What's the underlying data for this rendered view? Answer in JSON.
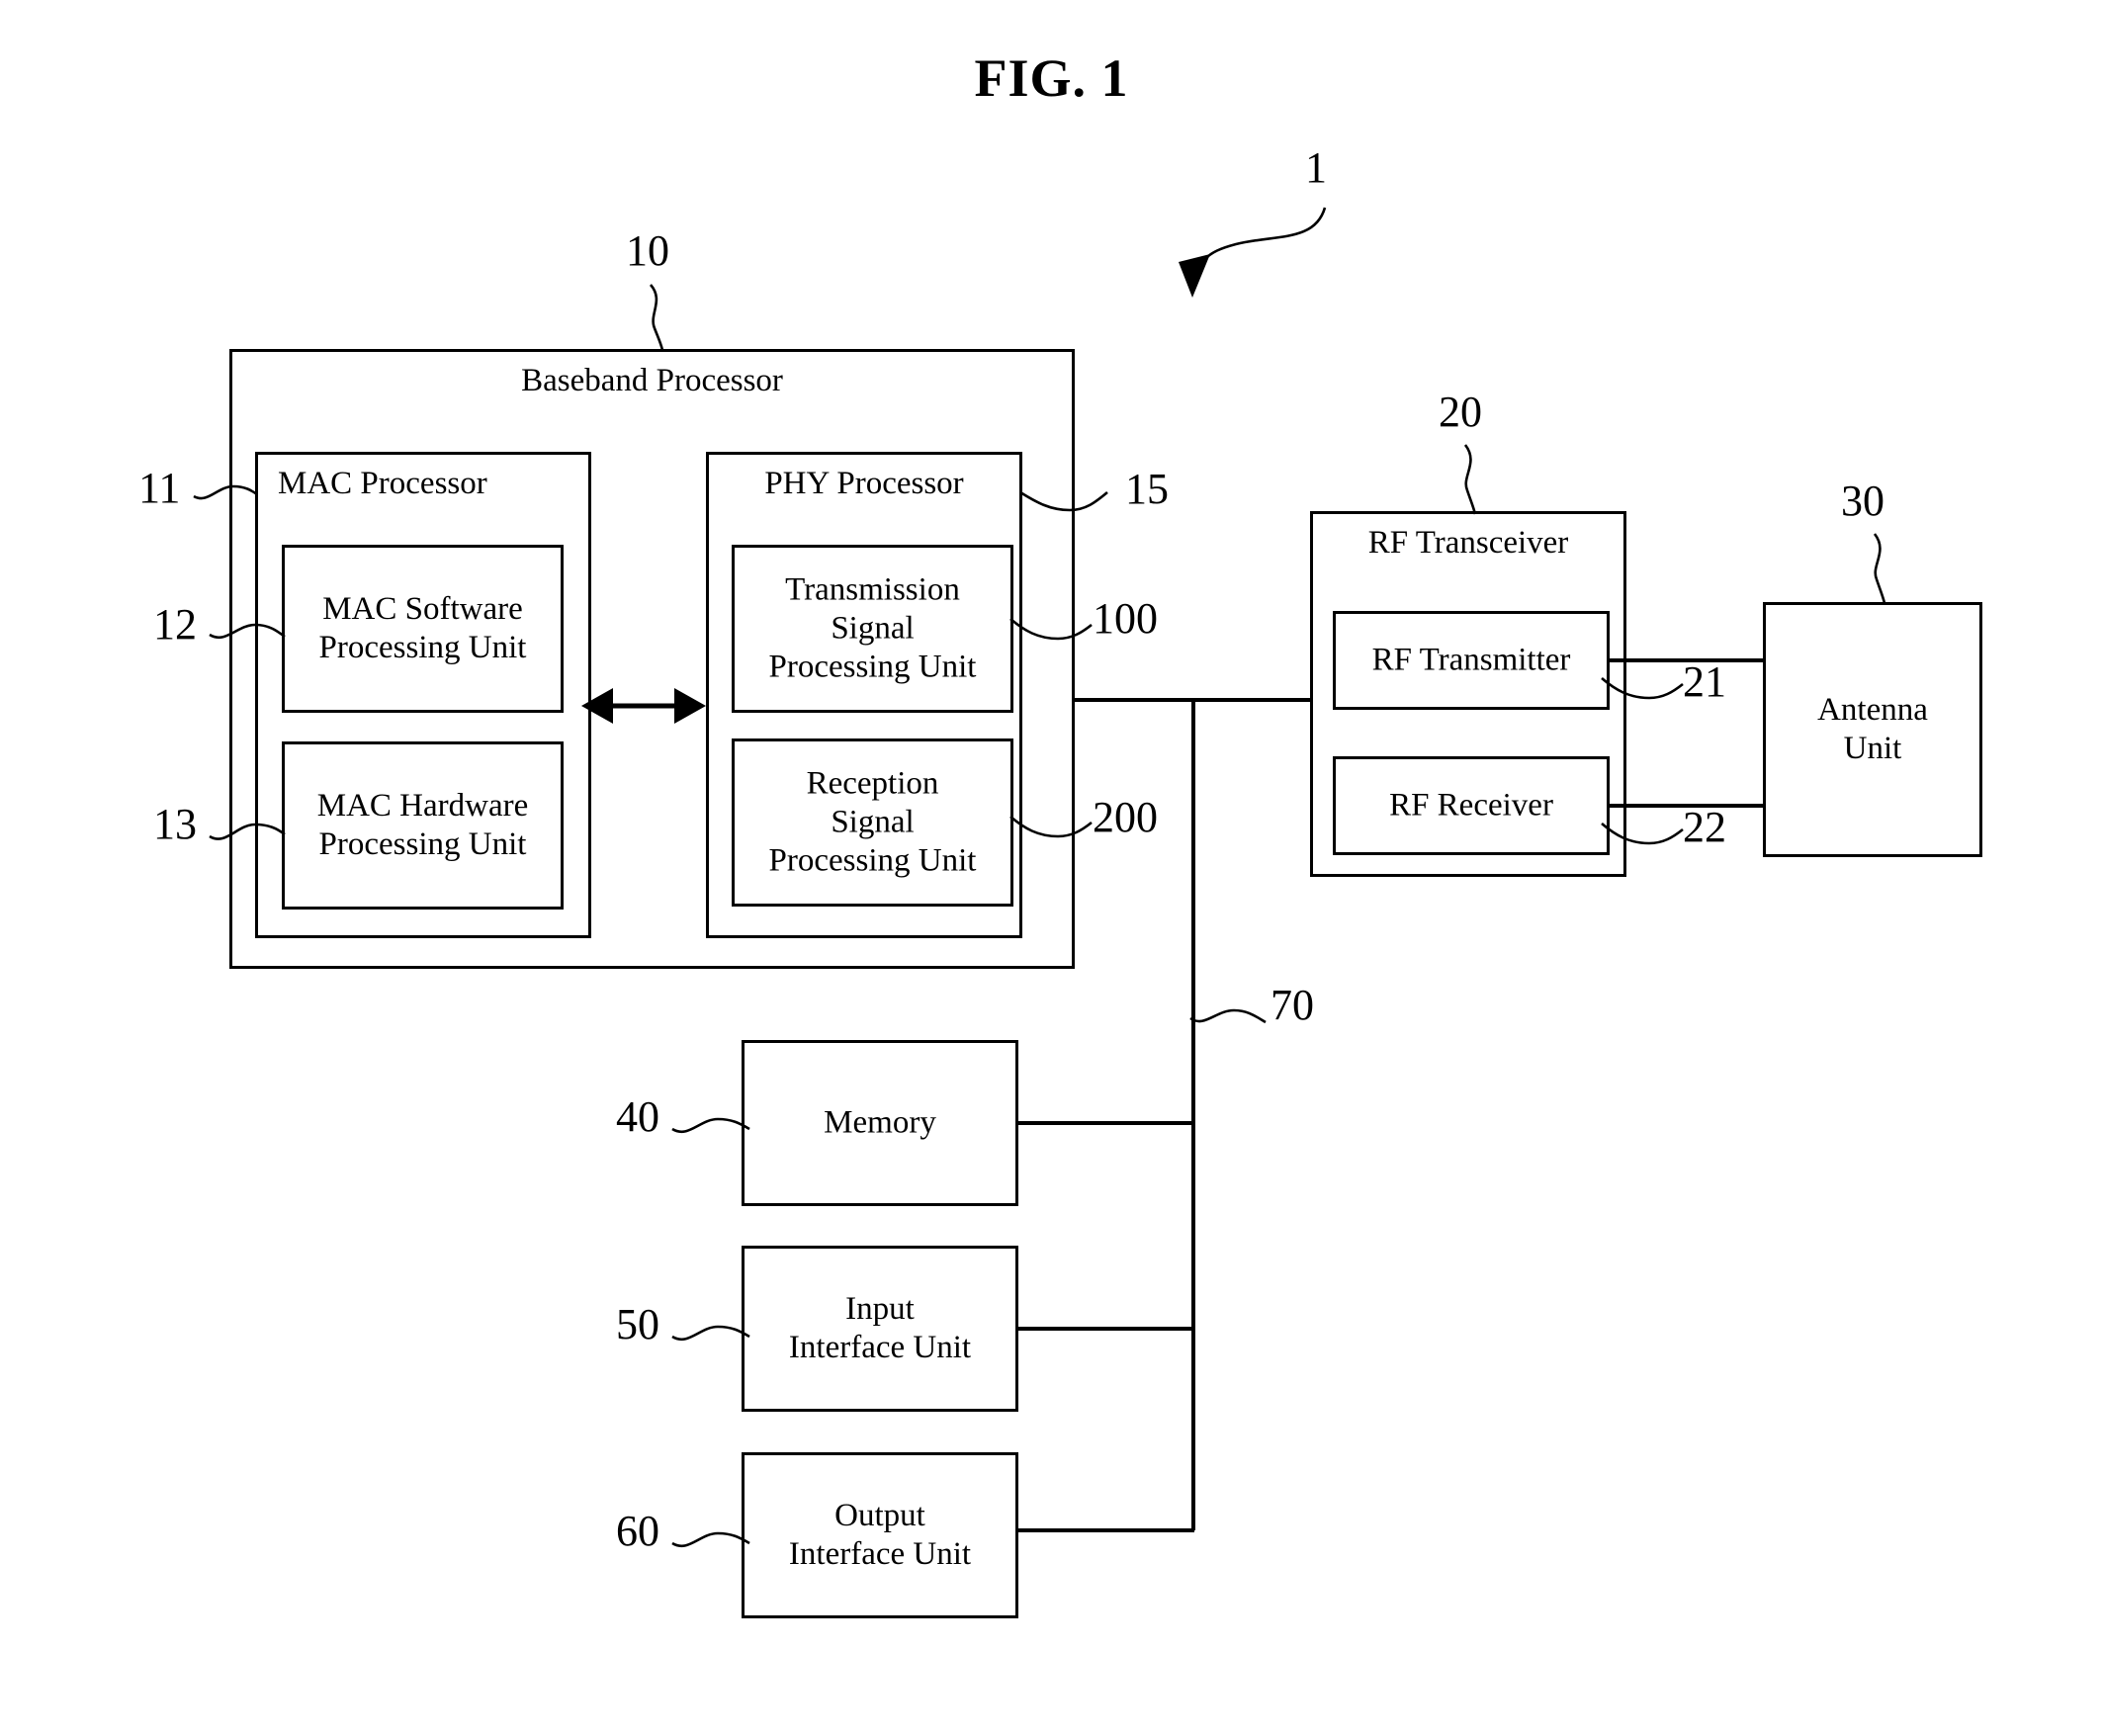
{
  "figure": {
    "title": "FIG. 1",
    "system_ref": "1"
  },
  "blocks": {
    "baseband_processor": {
      "label": "Baseband Processor",
      "ref": "10"
    },
    "mac_processor": {
      "label": "MAC Processor",
      "ref": "11"
    },
    "mac_software_processing_unit": {
      "label": "MAC Software\nProcessing Unit",
      "ref": "12"
    },
    "mac_hardware_processing_unit": {
      "label": "MAC Hardware\nProcessing Unit",
      "ref": "13"
    },
    "phy_processor": {
      "label": "PHY Processor",
      "ref": "15"
    },
    "transmission_signal_processing_unit": {
      "label": "Transmission\nSignal\nProcessing Unit",
      "ref": "100"
    },
    "reception_signal_processing_unit": {
      "label": "Reception\nSignal\nProcessing Unit",
      "ref": "200"
    },
    "rf_transceiver": {
      "label": "RF Transceiver",
      "ref": "20"
    },
    "rf_transmitter": {
      "label": "RF Transmitter",
      "ref": "21"
    },
    "rf_receiver": {
      "label": "RF Receiver",
      "ref": "22"
    },
    "antenna_unit": {
      "label": "Antenna\nUnit",
      "ref": "30"
    },
    "memory": {
      "label": "Memory",
      "ref": "40"
    },
    "input_interface_unit": {
      "label": "Input\nInterface Unit",
      "ref": "50"
    },
    "output_interface_unit": {
      "label": "Output\nInterface Unit",
      "ref": "60"
    },
    "bus": {
      "ref": "70"
    }
  },
  "chart_data": {
    "type": "diagram",
    "title": "FIG. 1",
    "nodes": [
      {
        "id": "1",
        "label": "",
        "role": "system-pointer"
      },
      {
        "id": "10",
        "label": "Baseband Processor"
      },
      {
        "id": "11",
        "label": "MAC Processor",
        "parent": "10"
      },
      {
        "id": "12",
        "label": "MAC Software Processing Unit",
        "parent": "11"
      },
      {
        "id": "13",
        "label": "MAC Hardware Processing Unit",
        "parent": "11"
      },
      {
        "id": "15",
        "label": "PHY Processor",
        "parent": "10"
      },
      {
        "id": "100",
        "label": "Transmission Signal Processing Unit",
        "parent": "15"
      },
      {
        "id": "200",
        "label": "Reception Signal Processing Unit",
        "parent": "15"
      },
      {
        "id": "20",
        "label": "RF Transceiver"
      },
      {
        "id": "21",
        "label": "RF Transmitter",
        "parent": "20"
      },
      {
        "id": "22",
        "label": "RF Receiver",
        "parent": "20"
      },
      {
        "id": "30",
        "label": "Antenna Unit"
      },
      {
        "id": "40",
        "label": "Memory"
      },
      {
        "id": "50",
        "label": "Input Interface Unit"
      },
      {
        "id": "60",
        "label": "Output Interface Unit"
      },
      {
        "id": "70",
        "label": "bus"
      }
    ],
    "edges": [
      {
        "from": "11",
        "to": "15",
        "style": "double-arrow"
      },
      {
        "from": "15",
        "to": "20",
        "style": "line"
      },
      {
        "from": "21",
        "to": "30",
        "style": "line"
      },
      {
        "from": "22",
        "to": "30",
        "style": "line"
      },
      {
        "from": "40",
        "to": "70",
        "style": "line"
      },
      {
        "from": "50",
        "to": "70",
        "style": "line"
      },
      {
        "from": "60",
        "to": "70",
        "style": "line"
      },
      {
        "from": "70",
        "to": "15",
        "style": "line"
      }
    ]
  }
}
